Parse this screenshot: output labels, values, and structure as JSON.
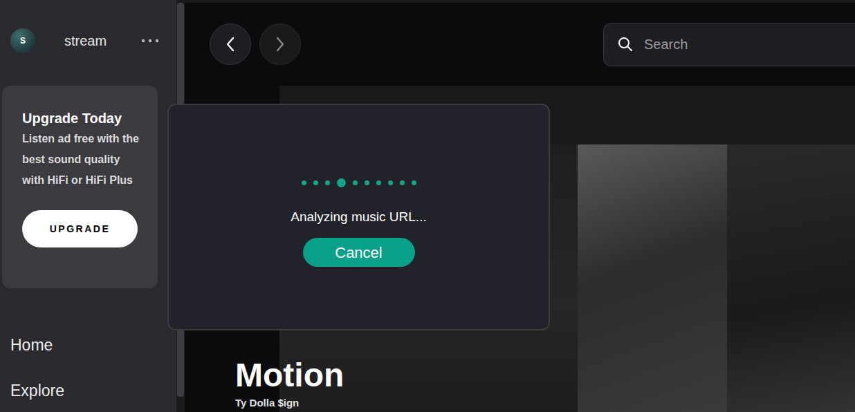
{
  "user": {
    "initial": "S",
    "name": "stream"
  },
  "upgrade_card": {
    "title": "Upgrade Today",
    "body": "Listen ad free with the best sound quality with HiFi or HiFi Plus",
    "button": "UPGRADE"
  },
  "nav": [
    {
      "label": "Home",
      "selected": false
    },
    {
      "label": "Explore",
      "selected": false
    }
  ],
  "search": {
    "placeholder": "Search"
  },
  "hero": {
    "title": "Motion",
    "artist": "Ty Dolla $ign"
  },
  "dialog": {
    "message": "Analyzing music URL...",
    "button": "Cancel",
    "dots": [
      {
        "active": false
      },
      {
        "active": false
      },
      {
        "active": false
      },
      {
        "active": true
      },
      {
        "active": false
      },
      {
        "active": false
      },
      {
        "active": false
      },
      {
        "active": false
      },
      {
        "active": false
      },
      {
        "active": false
      }
    ]
  }
}
